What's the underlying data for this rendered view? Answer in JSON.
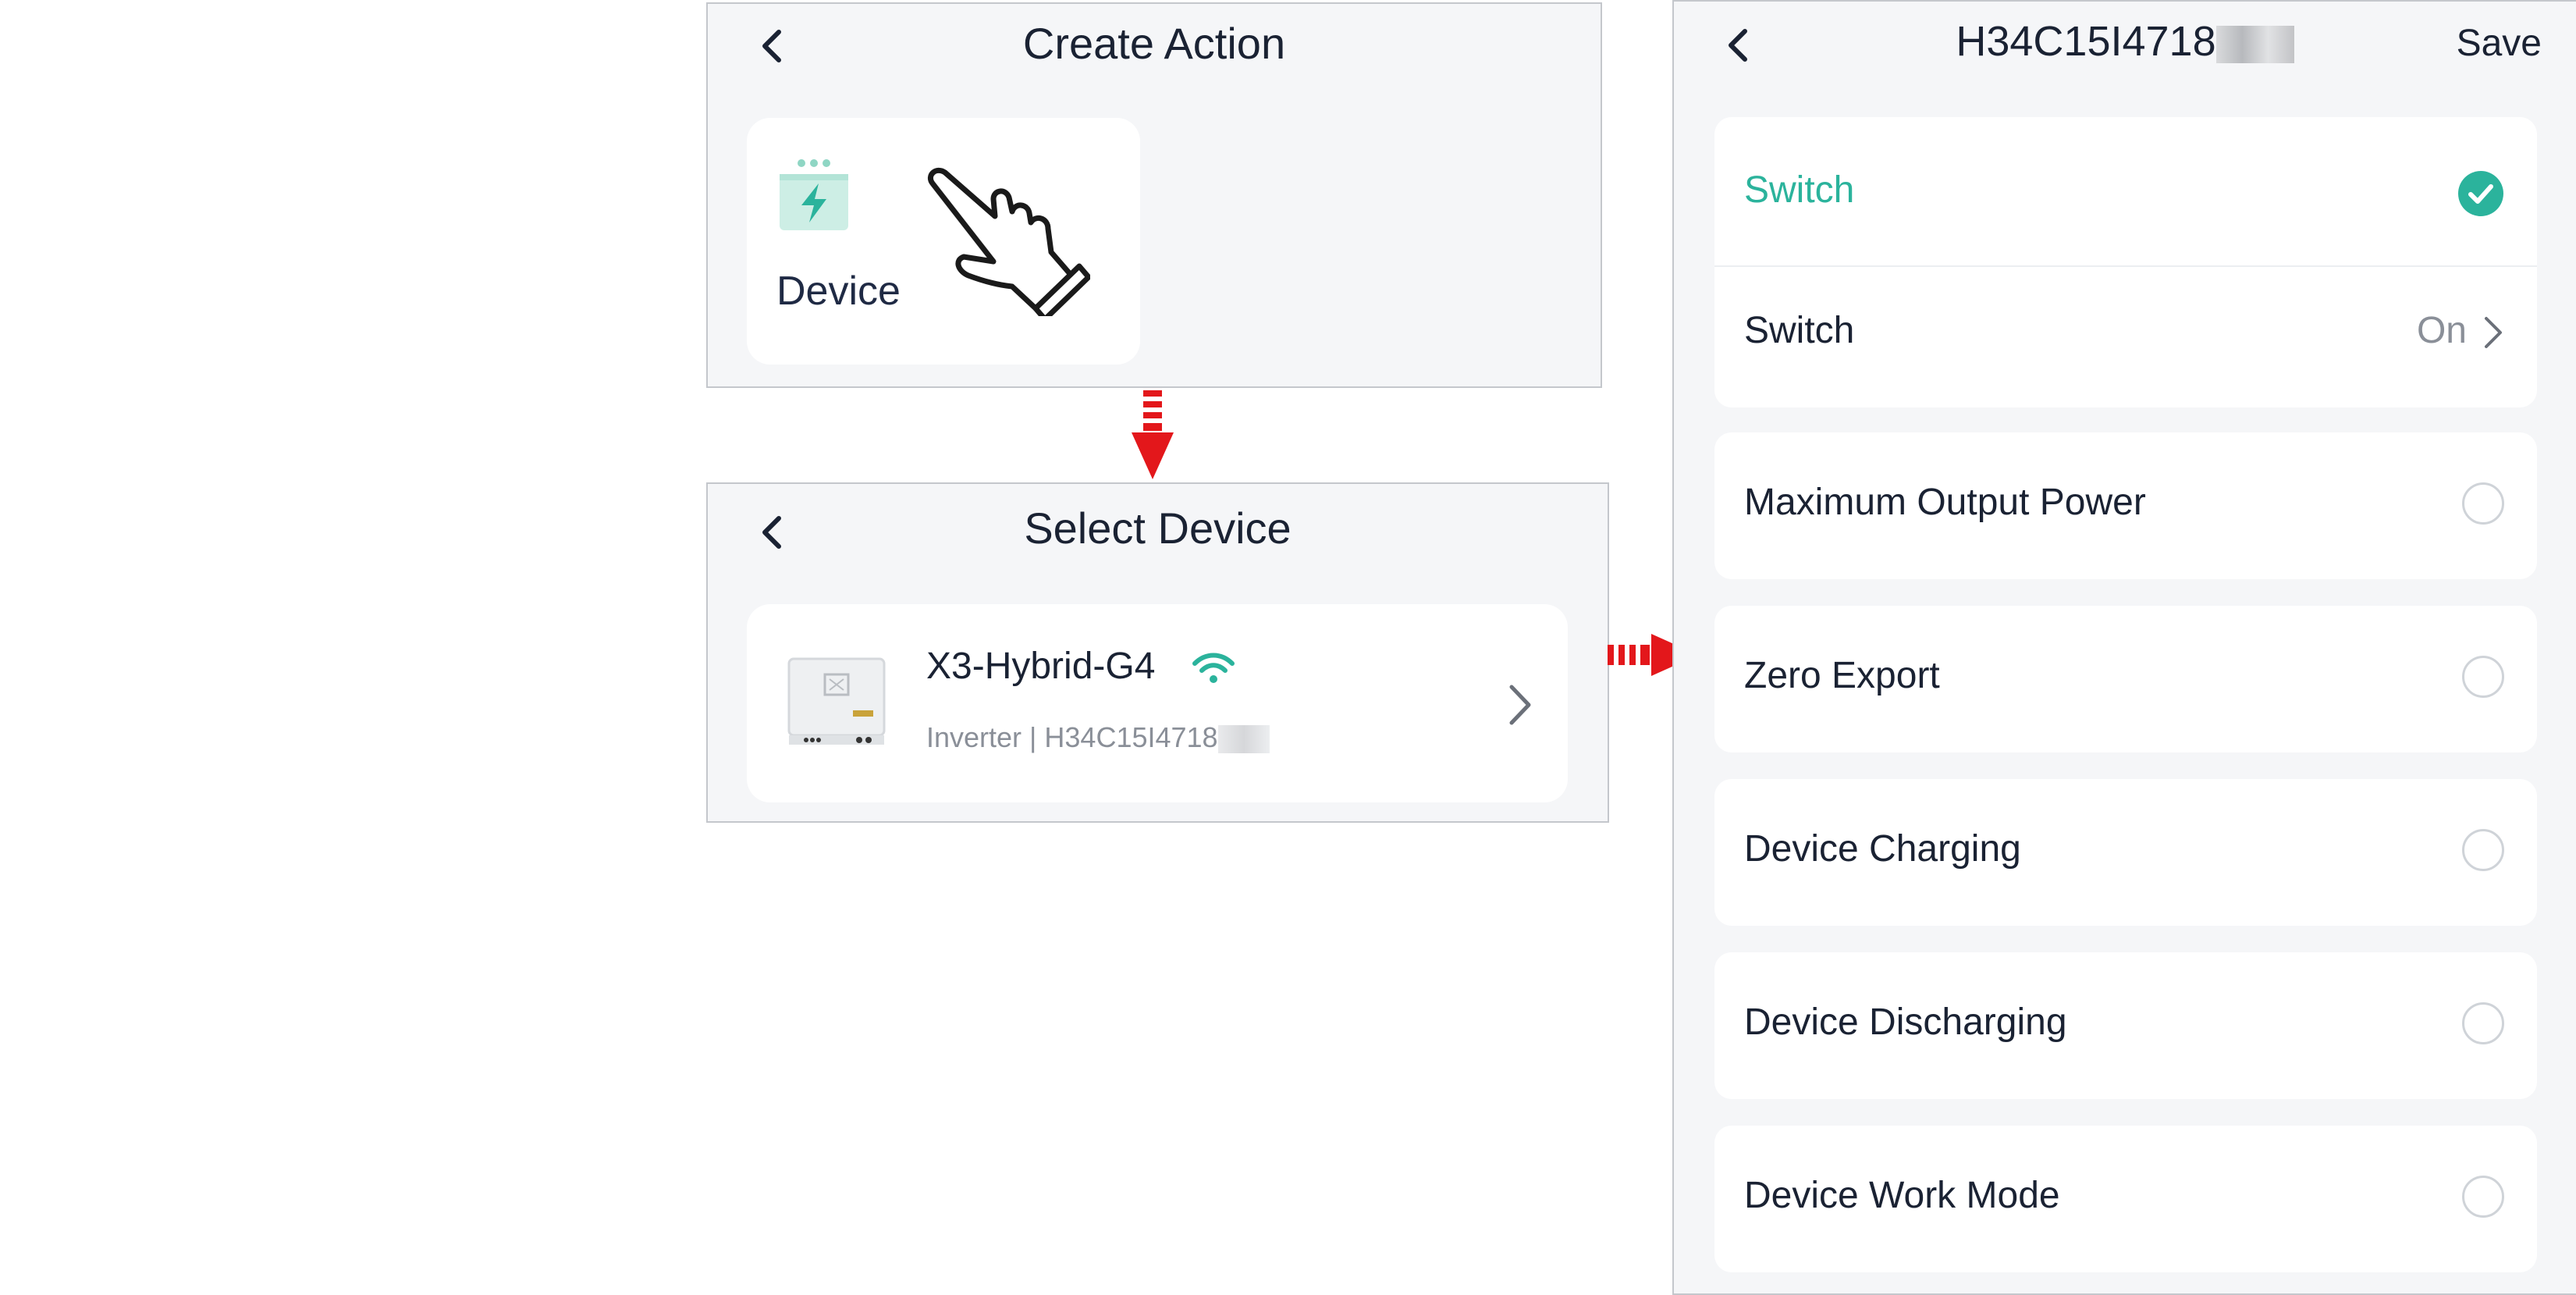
{
  "create_action": {
    "title": "Create Action",
    "device_tile_label": "Device",
    "icons": [
      "back-chevron-icon",
      "device-energy-icon",
      "pointing-hand-icon"
    ]
  },
  "select_device": {
    "title": "Select Device",
    "device_name": "X3-Hybrid-G4",
    "device_subtitle": "Inverter | H34C15I4718",
    "icons": [
      "back-chevron-icon",
      "inverter-thumbnail-icon",
      "wifi-icon",
      "chevron-right-icon"
    ]
  },
  "device_settings": {
    "title": "H34C15I4718",
    "save_label": "Save",
    "options": [
      {
        "label": "Switch",
        "selected": true
      },
      {
        "label": "Maximum Output Power",
        "selected": false
      },
      {
        "label": "Zero Export",
        "selected": false
      },
      {
        "label": "Device Charging",
        "selected": false
      },
      {
        "label": "Device Discharging",
        "selected": false
      },
      {
        "label": "Device Work Mode",
        "selected": false
      }
    ],
    "switch_param": {
      "label": "Switch",
      "value": "On"
    }
  },
  "colors": {
    "accent": "#2bb39c",
    "arrow": "#e3171b",
    "panel_bg": "#f5f6f8",
    "text": "#1a2233",
    "muted": "#8a8f98"
  }
}
